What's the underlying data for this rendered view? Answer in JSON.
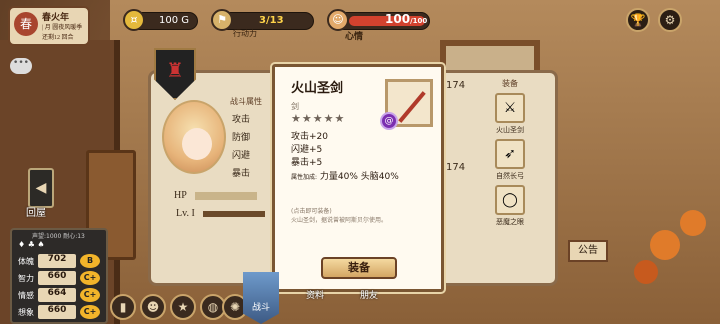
{
  "season": {
    "emblem": "春",
    "title": "春火年",
    "sub1": "| 月",
    "sub2": "圆夜风暖季",
    "sub3": "还剩12 回合"
  },
  "resources": {
    "coins": "100 G",
    "energy_label": "行动力",
    "energy": "3/13",
    "mood_label": "心情",
    "mood": "100",
    "mood_max": "100"
  },
  "top_icons": {
    "trophy": "trophy-icon",
    "settings": "gear-icon"
  },
  "exit_label": "回屋",
  "board_label": "公告",
  "character": {
    "battle_attr_header": "战斗属性",
    "stats": [
      "攻击",
      "防御",
      "闪避",
      "暴击"
    ],
    "hp_label": "HP",
    "lv_label": "Lv. I",
    "right_nums": [
      "174",
      "174"
    ]
  },
  "equipment": {
    "header": "装备",
    "slots": [
      {
        "icon": "sword-icon",
        "label": "火山圣剑"
      },
      {
        "icon": "bow-icon",
        "label": "自然长弓"
      },
      {
        "icon": "ring-icon",
        "label": "恶魔之眼"
      }
    ]
  },
  "item_popup": {
    "name": "火山圣剑",
    "type": "剑",
    "stars": "★★★★★",
    "attr1": "攻击+20",
    "attr2": "闪避+5",
    "attr3": "暴击+5",
    "bonus_prefix": "属性加成:",
    "bonus": "力量40%  头脑40%",
    "desc1": "(点击即可装备)",
    "desc2": "火山圣剑，据说曾被阿斯贝尔使用。",
    "equip_button": "装备"
  },
  "side_stats": {
    "header": "声望:1000  耐心:13",
    "rows": [
      {
        "label": "体魄",
        "value": "702",
        "grade": "B"
      },
      {
        "label": "智力",
        "value": "660",
        "grade": "C+"
      },
      {
        "label": "情感",
        "value": "664",
        "grade": "C+"
      },
      {
        "label": "想象",
        "value": "660",
        "grade": "C+"
      }
    ]
  },
  "nav": {
    "fight": "战斗",
    "tab1": "资料",
    "tab2": "朋友"
  }
}
